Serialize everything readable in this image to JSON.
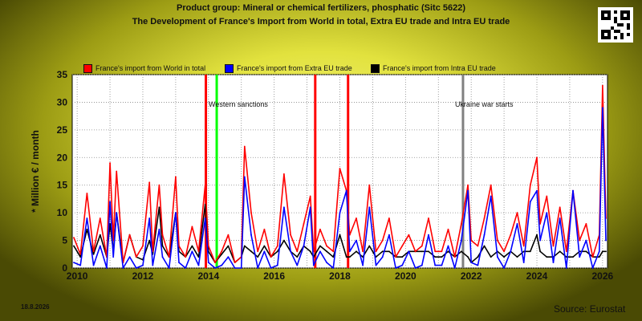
{
  "header": {
    "title": "Product group: Mineral or chemical fertilizers, phosphatic (Sitc 5622)",
    "subtitle": "The Development of France's Import from World in total, Extra EU trade and Intra EU trade"
  },
  "footer": {
    "date": "18.8.2026",
    "source": "Source: Eurostat"
  },
  "colors": {
    "world": "#ff0000",
    "extra": "#0000ff",
    "intra": "#000000",
    "sanctions": "#00ff00",
    "war": "#808080"
  },
  "chart_data": {
    "type": "line",
    "title": "Product group: Mineral or chemical fertilizers, phosphatic (Sitc 5622)",
    "subtitle": "The Development of France's Import from World in total, Extra EU trade and Intra EU trade",
    "ylabel": "* Million € / month",
    "xlabel": "",
    "xlim": [
      2009.85,
      2026.15
    ],
    "ylim": [
      0,
      35
    ],
    "yticks": [
      0,
      5,
      10,
      15,
      20,
      25,
      30,
      35
    ],
    "xticks": [
      2010,
      2012,
      2014,
      2016,
      2018,
      2020,
      2022,
      2024,
      2026
    ],
    "grid": true,
    "legend_position": "top",
    "event_markers": [
      {
        "x": 2013.92,
        "color": "red",
        "label": ""
      },
      {
        "x": 2014.25,
        "color": "green",
        "label": "Western sanctions"
      },
      {
        "x": 2017.25,
        "color": "red",
        "label": ""
      },
      {
        "x": 2018.25,
        "color": "red",
        "label": ""
      },
      {
        "x": 2021.75,
        "color": "gray",
        "label": "Ukraine war starts"
      }
    ],
    "series": [
      {
        "name": "France's import from World in total",
        "color": "#ff0000",
        "x": [
          2009.9,
          2010.1,
          2010.3,
          2010.5,
          2010.7,
          2010.9,
          2011.0,
          2011.1,
          2011.2,
          2011.4,
          2011.6,
          2011.8,
          2012.0,
          2012.2,
          2012.3,
          2012.5,
          2012.6,
          2012.8,
          2013.0,
          2013.1,
          2013.3,
          2013.5,
          2013.7,
          2013.9,
          2014.0,
          2014.2,
          2014.4,
          2014.6,
          2014.8,
          2015.0,
          2015.1,
          2015.3,
          2015.5,
          2015.7,
          2015.9,
          2016.1,
          2016.3,
          2016.5,
          2016.7,
          2016.9,
          2017.1,
          2017.2,
          2017.4,
          2017.6,
          2017.8,
          2018.0,
          2018.2,
          2018.3,
          2018.5,
          2018.7,
          2018.9,
          2019.1,
          2019.3,
          2019.5,
          2019.7,
          2019.9,
          2020.1,
          2020.3,
          2020.5,
          2020.7,
          2020.9,
          2021.1,
          2021.3,
          2021.5,
          2021.7,
          2021.9,
          2022.0,
          2022.2,
          2022.4,
          2022.6,
          2022.8,
          2023.0,
          2023.2,
          2023.4,
          2023.6,
          2023.8,
          2024.0,
          2024.1,
          2024.3,
          2024.5,
          2024.7,
          2024.9,
          2025.1,
          2025.3,
          2025.5,
          2025.7,
          2025.9,
          2026.0,
          2026.1
        ],
        "y": [
          5.5,
          2.5,
          13.5,
          3,
          9,
          2,
          19,
          5,
          17.5,
          1,
          6,
          2,
          4,
          15.5,
          3,
          15,
          6,
          2,
          16.5,
          4,
          2,
          7.5,
          3,
          15,
          4,
          1,
          3,
          6,
          1,
          2,
          22,
          10,
          3,
          7,
          2,
          4,
          17,
          6,
          3,
          8,
          13,
          3,
          7,
          4,
          3,
          18,
          14,
          6,
          9,
          3,
          15,
          3,
          5,
          9,
          2,
          4,
          6,
          3,
          4,
          9,
          3,
          3,
          7,
          2,
          8,
          15,
          5,
          4,
          9,
          15,
          5,
          3,
          6,
          10,
          4,
          15,
          20,
          8,
          13,
          4,
          11,
          3,
          14,
          5,
          8,
          2,
          6,
          33,
          9
        ]
      },
      {
        "name": "France's import from Extra EU trade",
        "color": "#0000ff",
        "x": [
          2009.9,
          2010.1,
          2010.3,
          2010.5,
          2010.7,
          2010.9,
          2011.0,
          2011.1,
          2011.2,
          2011.4,
          2011.6,
          2011.8,
          2012.0,
          2012.2,
          2012.3,
          2012.5,
          2012.6,
          2012.8,
          2013.0,
          2013.1,
          2013.3,
          2013.5,
          2013.7,
          2013.9,
          2014.0,
          2014.2,
          2014.4,
          2014.6,
          2014.8,
          2015.0,
          2015.1,
          2015.3,
          2015.5,
          2015.7,
          2015.9,
          2016.1,
          2016.3,
          2016.5,
          2016.7,
          2016.9,
          2017.1,
          2017.2,
          2017.4,
          2017.6,
          2017.8,
          2018.0,
          2018.2,
          2018.3,
          2018.5,
          2018.7,
          2018.9,
          2019.1,
          2019.3,
          2019.5,
          2019.7,
          2019.9,
          2020.1,
          2020.3,
          2020.5,
          2020.7,
          2020.9,
          2021.1,
          2021.3,
          2021.5,
          2021.7,
          2021.9,
          2022.0,
          2022.2,
          2022.4,
          2022.6,
          2022.8,
          2023.0,
          2023.2,
          2023.4,
          2023.6,
          2023.8,
          2024.0,
          2024.1,
          2024.3,
          2024.5,
          2024.7,
          2024.9,
          2025.1,
          2025.3,
          2025.5,
          2025.7,
          2025.9,
          2026.0,
          2026.1
        ],
        "y": [
          1,
          0.5,
          9,
          0.5,
          4,
          0,
          12,
          2,
          10,
          0,
          2,
          0,
          0.5,
          9,
          0.5,
          7,
          2,
          0,
          10,
          1,
          0,
          3,
          0.5,
          9,
          1,
          0,
          0.5,
          2,
          0,
          0,
          16.5,
          6,
          0,
          3,
          0,
          0.5,
          11,
          3,
          0.5,
          4,
          11,
          0.5,
          3,
          1,
          0,
          10,
          14,
          3,
          5,
          0.5,
          11,
          0.5,
          2,
          6,
          0,
          0.5,
          3,
          0,
          0.5,
          6,
          0.5,
          0.5,
          4,
          0,
          5,
          14,
          1,
          0.5,
          6,
          13,
          2,
          0,
          3,
          8,
          1,
          12,
          14,
          5,
          10,
          1,
          9,
          0,
          14,
          2,
          5,
          0,
          3,
          29,
          5
        ]
      },
      {
        "name": "France's import from Intra EU trade",
        "color": "#000000",
        "x": [
          2009.9,
          2010.1,
          2010.3,
          2010.5,
          2010.7,
          2010.9,
          2011.0,
          2011.1,
          2011.2,
          2011.4,
          2011.6,
          2011.8,
          2012.0,
          2012.2,
          2012.3,
          2012.5,
          2012.6,
          2012.8,
          2013.0,
          2013.1,
          2013.3,
          2013.5,
          2013.7,
          2013.9,
          2014.0,
          2014.2,
          2014.4,
          2014.6,
          2014.8,
          2015.0,
          2015.1,
          2015.3,
          2015.5,
          2015.7,
          2015.9,
          2016.1,
          2016.3,
          2016.5,
          2016.7,
          2016.9,
          2017.1,
          2017.2,
          2017.4,
          2017.6,
          2017.8,
          2018.0,
          2018.2,
          2018.3,
          2018.5,
          2018.7,
          2018.9,
          2019.1,
          2019.3,
          2019.5,
          2019.7,
          2019.9,
          2020.1,
          2020.3,
          2020.5,
          2020.7,
          2020.9,
          2021.1,
          2021.3,
          2021.5,
          2021.7,
          2021.9,
          2022.0,
          2022.2,
          2022.4,
          2022.6,
          2022.8,
          2023.0,
          2023.2,
          2023.4,
          2023.6,
          2023.8,
          2024.0,
          2024.1,
          2024.3,
          2024.5,
          2024.7,
          2024.9,
          2025.1,
          2025.3,
          2025.5,
          2025.7,
          2025.9,
          2026.0,
          2026.1
        ],
        "y": [
          4,
          2,
          7,
          2.5,
          6,
          2,
          8,
          3,
          10,
          1,
          6,
          2,
          1.5,
          5,
          2.5,
          11,
          4,
          2,
          10,
          3,
          2,
          4,
          2,
          11.5,
          3,
          1,
          2.5,
          4,
          1,
          2,
          4,
          3,
          2,
          4,
          2,
          3,
          5,
          3,
          2,
          4,
          3,
          2,
          4,
          3,
          2,
          6,
          2,
          2,
          3,
          2,
          4,
          2,
          3,
          3,
          2,
          2,
          3,
          3,
          3,
          3,
          2,
          2,
          3,
          2,
          3,
          2,
          1,
          2,
          4,
          2,
          3,
          2,
          3,
          2,
          3,
          3,
          6,
          3,
          2,
          2,
          3,
          2,
          2,
          3,
          3,
          2,
          2,
          3,
          3
        ]
      }
    ]
  }
}
